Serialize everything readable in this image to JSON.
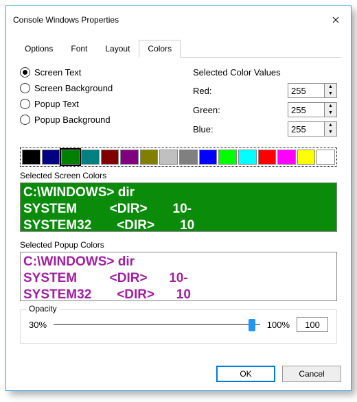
{
  "title": "Console Windows Properties",
  "tabs": [
    "Options",
    "Font",
    "Layout",
    "Colors"
  ],
  "active_tab": "Colors",
  "radios": {
    "r0": "Screen Text",
    "r1": "Screen Background",
    "r2": "Popup Text",
    "r3": "Popup Background",
    "selected": "Screen Text"
  },
  "color_values": {
    "title": "Selected Color Values",
    "red_label": "Red:",
    "green_label": "Green:",
    "blue_label": "Blue:",
    "red": "255",
    "green": "255",
    "blue": "255"
  },
  "palette": [
    {
      "c": "#000000",
      "sel": false
    },
    {
      "c": "#000080",
      "sel": false
    },
    {
      "c": "#008000",
      "sel": true
    },
    {
      "c": "#008080",
      "sel": false
    },
    {
      "c": "#800000",
      "sel": false
    },
    {
      "c": "#800080",
      "sel": false
    },
    {
      "c": "#808000",
      "sel": false
    },
    {
      "c": "#c0c0c0",
      "sel": false
    },
    {
      "c": "#808080",
      "sel": false
    },
    {
      "c": "#0000ff",
      "sel": false
    },
    {
      "c": "#00ff00",
      "sel": false
    },
    {
      "c": "#00ffff",
      "sel": false
    },
    {
      "c": "#ff0000",
      "sel": false
    },
    {
      "c": "#ff00ff",
      "sel": false
    },
    {
      "c": "#ffff00",
      "sel": false
    },
    {
      "c": "#ffffff",
      "sel": false
    }
  ],
  "screen_preview": {
    "label": "Selected Screen Colors",
    "line1": "C:\\WINDOWS> dir",
    "line2": "SYSTEM         <DIR>       10-",
    "line3": "SYSTEM32       <DIR>       10"
  },
  "popup_preview": {
    "label": "Selected Popup Colors",
    "line1": "C:\\WINDOWS> dir",
    "line2": "SYSTEM         <DIR>      10-",
    "line3": "SYSTEM32       <DIR>      10"
  },
  "opacity": {
    "title": "Opacity",
    "min_label": "30%",
    "max_label": "100%",
    "value": "100",
    "thumb_percent": 96
  },
  "buttons": {
    "ok": "OK",
    "cancel": "Cancel"
  }
}
